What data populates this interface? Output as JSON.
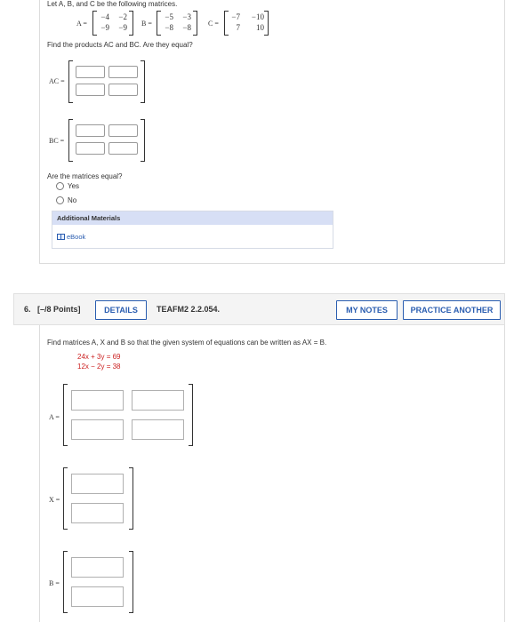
{
  "q5": {
    "intro": "Let A, B, and C be the following matrices.",
    "matrix_a": {
      "label": "A =",
      "r1c1": "−4",
      "r1c2": "−2",
      "r2c1": "−9",
      "r2c2": "−9"
    },
    "matrix_b": {
      "label": "B =",
      "r1c1": "−5",
      "r1c2": "−3",
      "r2c1": "−8",
      "r2c2": "−8"
    },
    "matrix_c": {
      "label": "C =",
      "r1c1": "−7",
      "r1c2": "−10",
      "r2c1": "7",
      "r2c2": "10"
    },
    "prompt": "Find the products AC and BC. Are they equal?",
    "ac_label": "AC =",
    "bc_label": "BC =",
    "question": "Are the matrices equal?",
    "options": [
      "Yes",
      "No"
    ],
    "additional_materials": "Additional Materials",
    "ebook": "eBook"
  },
  "q6": {
    "number": "6.",
    "points": "[–/8 Points]",
    "details_button": "DETAILS",
    "code": "TEAFM2 2.2.054.",
    "my_notes_button": "MY NOTES",
    "practice_button": "PRACTICE ANOTHER",
    "prompt": "Find matrices A, X and B so that the given system of equations can be written as AX = B.",
    "eq1": "24x + 3y = 69",
    "eq2": "12x − 2y = 38",
    "a_label": "A =",
    "x_label": "X =",
    "b_label": "B ="
  },
  "colors": {
    "accent": "#2a5db0",
    "equation": "#cc2222",
    "panel_header": "#d7dff5"
  }
}
